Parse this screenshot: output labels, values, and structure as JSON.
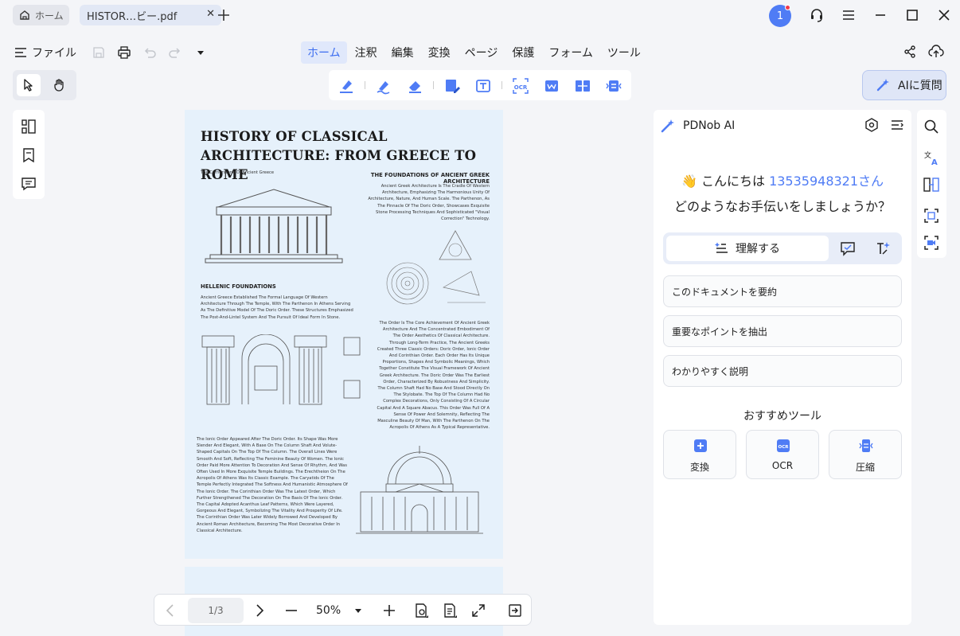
{
  "titlebar": {
    "home_tab_label": "ホーム",
    "doc_tab_label": "HISTOR…ビー.pdf",
    "notification_count": "1"
  },
  "menubar": {
    "file_label": "ファイル",
    "tabs": [
      "ホーム",
      "注釈",
      "編集",
      "変換",
      "ページ",
      "保護",
      "フォーム",
      "ツール"
    ],
    "active_tab": "ホーム"
  },
  "toolbar": {
    "ai_button_label": "AIに質問"
  },
  "document": {
    "title": "HISTORY OF CLASSICAL  ARCHITECTURE: FROM GREECE TO ROME",
    "subtitle": "The Cornerstone Of Ancient Greece",
    "section1_heading": "THE FOUNDATIONS OF ANCIENT GREEK ARCHITECTURE",
    "section1_text": "Ancient Greek Architecture Is The Cradle Of Western Architecture, Emphasizing The Harmonious Unity Of Architecture, Nature, And Human Scale. The Parthenon, As The Pinnacle Of The Doric Order, Showcases Exquisite Stone Processing Techniques And Sophisticated \"Visual Correction\" Technology.",
    "section2_heading": "HELLENIC FOUNDATIONS",
    "section2_text": "Ancient Greece Established The Formal Language Of Western Architecture Through The Temple, With The Parthenon In Athens Serving As The Definitive Model Of The Doric Order. These Structures Emphasized The Post-And-Lintel System And The Pursuit Of Ideal Form In Stone.",
    "section3_text": "The Order Is The Core Achievement Of Ancient Greek Architecture And The Concentrated Embodiment Of The Order Aesthetics Of Classical Architecture. Through Long-Term Practice, The Ancient Greeks Created Three Classic Orders: Doric Order, Ionic Order And Corinthian Order. Each Order Has Its Unique Proportions, Shapes And Symbolic Meanings, Which Together Constitute The Visual Framework Of Ancient Greek Architecture. The Doric Order Was The Earliest Order, Characterized By Robustness And Simplicity. The Column Shaft Had No Base And Stood Directly On The Stylobate. The Top Of The Column Had No Complex Decorations, Only Consisting Of A Circular Capital And A Square Abacus. This Order Was Full Of A Sense Of Power And Solemnity, Reflecting The Masculine Beauty Of Man, With The Parthenon On The Acropolis Of Athens As A Typical Representative.",
    "section4_text": "The Ionic Order Appeared After The Doric Order. Its Shape Was More Slender And Elegant, With A Base On The Column Shaft And Volute-Shaped Capitals On The Top Of The Column. The Overall Lines Were Smooth And Soft, Reflecting The Feminine Beauty Of Women. The Ionic Order Paid More Attention To Decoration And Sense Of Rhythm, And Was Often Used In More Exquisite Temple Buildings. The Erechtheion On The Acropolis Of Athens Was Its Classic Example. The Caryatids Of The Temple Perfectly Integrated The Softness And Humanistic Atmosphere Of The Ionic Order. The Corinthian Order Was The Latest Order, Which Further Strengthened The Decoration On The Basis Of The Ionic Order. The Capital Adopted Acanthus Leaf Patterns, Which Were Layered, Gorgeous And Elegant, Symbolizing The Vitality And Prosperity Of Life. The Corinthian Order Was Later Widely Borrowed And Developed By Ancient Roman Architecture, Becoming The Most Decorative Order In Classical Architecture."
  },
  "bottombar": {
    "page_indicator": "1/3",
    "zoom": "50%"
  },
  "ai_panel": {
    "title": "PDNob AI",
    "greeting_prefix": "こんにちは ",
    "user_name": "13535948321さん",
    "greeting_line2": "どのようなお手伝いをしましょうか？",
    "active_mode": "理解する",
    "prompts": [
      "このドキュメントを要約",
      "重要なポイントを抽出",
      "わかりやすく説明"
    ],
    "recommended_title": "おすすめツール",
    "tools": [
      "変換",
      "OCR",
      "圧縮"
    ]
  },
  "colors": {
    "accent": "#4f7cf5",
    "page_bg": "#e6f1fb",
    "app_bg": "#f4f5f8"
  }
}
